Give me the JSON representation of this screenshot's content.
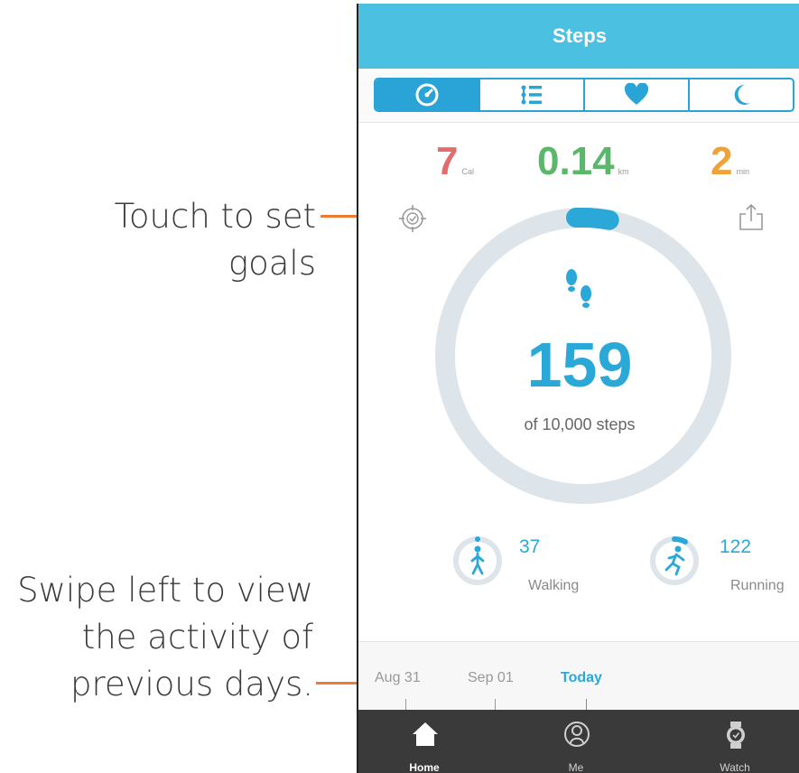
{
  "annotations": {
    "goals_line1": "Touch to set",
    "goals_line2": "goals",
    "swipe_line1": "Swipe left to view",
    "swipe_line2": "the activity of",
    "swipe_line3": "previous days.",
    "accent_color": "#ee7b30"
  },
  "app": {
    "title": "Steps",
    "brand_color": "#4bc0e1",
    "accent_color": "#2aa8d8"
  },
  "tabs": [
    {
      "icon": "speedometer-icon",
      "active": true
    },
    {
      "icon": "list-icon",
      "active": false
    },
    {
      "icon": "heart-icon",
      "active": false
    },
    {
      "icon": "moon-icon",
      "active": false
    }
  ],
  "stats": {
    "calories": {
      "value": "7",
      "unit": "Cal",
      "color": "#e26d6d"
    },
    "distance": {
      "value": "0.14",
      "unit": "km",
      "color": "#5bb76a"
    },
    "minutes": {
      "value": "2",
      "unit": "min",
      "color": "#f0a23a"
    }
  },
  "goal": {
    "steps": "159",
    "target_text": "of 10,000 steps",
    "progress_fraction": 0.0159
  },
  "activity": {
    "walking": {
      "value": "37",
      "label": "Walking"
    },
    "running": {
      "value": "122",
      "label": "Running"
    }
  },
  "timeline": {
    "dates": [
      "Aug 31",
      "Sep 01",
      "Today"
    ],
    "selected": "Today"
  },
  "nav": {
    "items": [
      {
        "label": "Home",
        "icon": "home-icon",
        "active": true
      },
      {
        "label": "Me",
        "icon": "profile-icon",
        "active": false
      },
      {
        "label": "Watch",
        "icon": "watch-icon",
        "active": false
      }
    ]
  }
}
